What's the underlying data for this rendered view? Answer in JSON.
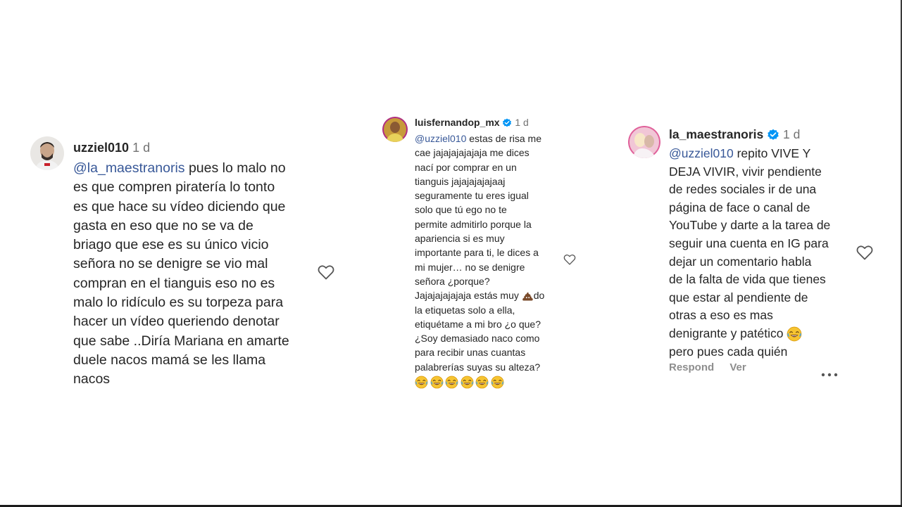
{
  "comments": [
    {
      "username": "uzziel010",
      "time": "1 d",
      "verified": false,
      "mention": "@la_maestranoris",
      "lines": [
        " pues lo malo no",
        "es que compren piratería lo tonto",
        "es que hace su vídeo diciendo que",
        "gasta en eso que no se va de",
        "briago que ese es su único vicio",
        "señora no se denigre se vio mal",
        "compran en el tianguis eso no es",
        "malo lo ridículo es su torpeza para",
        "hacer un vídeo queriendo denotar",
        "que sabe ..Diría Mariana en amarte",
        "duele nacos mamá se les llama",
        "nacos"
      ]
    },
    {
      "username": "luisfernandop_mx",
      "time": "1 d",
      "verified": true,
      "mention": "@uzziel010",
      "lines": [
        " estas de risa me",
        "cae jajajajajajaja me dices",
        "nací por comprar en un",
        "tianguis jajajajajajaaj",
        "seguramente tu eres igual",
        "solo que tú ego no te",
        "permite admitirlo porque la",
        "apariencia si es muy",
        "importante para ti, le dices a",
        "mi mujer… no se denigre",
        "señora ¿porque?",
        "Jajajajajajaja estás muy ",
        "do",
        "la etiquetas solo a ella,",
        "etiquétame a mi bro ¿o que?",
        "¿Soy demasiado naco como",
        "para recibir unas cuantas",
        "palabrerías suyas su alteza?"
      ],
      "emoji_row": [
        "😂",
        "😂",
        "😂",
        "😂",
        "😂",
        "😂"
      ]
    },
    {
      "username": "la_maestranoris",
      "time": "1 d",
      "verified": true,
      "mention": "@uzziel010",
      "lines": [
        " repito VIVE Y",
        "DEJA VIVIR, vivir pendiente",
        "de redes sociales ir de una",
        "página de face o canal de",
        "YouTube y darte a la tarea de",
        "seguir una cuenta en IG para",
        "dejar un comentario habla",
        "de la falta de vida que tienes",
        "que estar al pendiente de",
        "otras a eso es mas",
        "denigrante y patético ",
        "pero pues cada quién"
      ],
      "actions": {
        "reply": "Respond",
        "view": "Ver"
      }
    }
  ],
  "icons": {
    "like": "heart-icon",
    "verified": "verified-badge-icon",
    "more": "more-options-icon",
    "emoji_laugh": "laughing-emoji",
    "emoji_poop": "poop-emoji"
  },
  "colors": {
    "mention": "#385898",
    "verified": "#0095f6",
    "meta": "#737373",
    "text": "#262626"
  }
}
